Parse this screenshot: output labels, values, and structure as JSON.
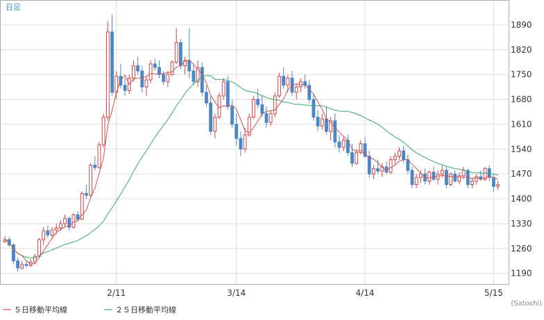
{
  "chart_data": {
    "type": "candlestick",
    "period_label": "日足",
    "credit": "(Satoshi)",
    "y_ticks": [
      1190,
      1260,
      1330,
      1400,
      1470,
      1540,
      1610,
      1680,
      1750,
      1820,
      1890
    ],
    "ylim": [
      1160,
      1960
    ],
    "x_ticks": [
      {
        "label": "2/11",
        "index": 26
      },
      {
        "label": "3/14",
        "index": 54
      },
      {
        "label": "4/14",
        "index": 84
      },
      {
        "label": "5/15",
        "index": 114
      }
    ],
    "n_days": 118,
    "up_color": "#cc4444",
    "down_color": "#4a86c8",
    "ma5_color": "#cc5555",
    "ma25_color": "#33aa66",
    "legend": [
      {
        "label": "５日移動平均線",
        "color": "#cc5555"
      },
      {
        "label": "２５日移動平均線",
        "color": "#33aa66"
      }
    ],
    "candles": [
      [
        1280,
        1295,
        1275,
        1285
      ],
      [
        1285,
        1292,
        1265,
        1270
      ],
      [
        1270,
        1275,
        1215,
        1225
      ],
      [
        1225,
        1235,
        1195,
        1205
      ],
      [
        1205,
        1225,
        1200,
        1215
      ],
      [
        1215,
        1225,
        1205,
        1212
      ],
      [
        1212,
        1230,
        1208,
        1222
      ],
      [
        1222,
        1245,
        1215,
        1238
      ],
      [
        1238,
        1290,
        1232,
        1285
      ],
      [
        1285,
        1320,
        1270,
        1310
      ],
      [
        1310,
        1325,
        1290,
        1298
      ],
      [
        1298,
        1320,
        1288,
        1312
      ],
      [
        1312,
        1330,
        1300,
        1318
      ],
      [
        1318,
        1340,
        1310,
        1330
      ],
      [
        1330,
        1355,
        1320,
        1345
      ],
      [
        1345,
        1350,
        1310,
        1320
      ],
      [
        1320,
        1360,
        1315,
        1355
      ],
      [
        1355,
        1365,
        1335,
        1342
      ],
      [
        1342,
        1420,
        1340,
        1415
      ],
      [
        1415,
        1440,
        1400,
        1410
      ],
      [
        1410,
        1500,
        1405,
        1495
      ],
      [
        1495,
        1520,
        1480,
        1488
      ],
      [
        1488,
        1560,
        1485,
        1552
      ],
      [
        1552,
        1640,
        1545,
        1630
      ],
      [
        1630,
        1900,
        1620,
        1870
      ],
      [
        1870,
        1920,
        1690,
        1700
      ],
      [
        1700,
        1760,
        1680,
        1745
      ],
      [
        1745,
        1780,
        1710,
        1720
      ],
      [
        1720,
        1740,
        1690,
        1705
      ],
      [
        1705,
        1750,
        1695,
        1740
      ],
      [
        1740,
        1790,
        1730,
        1775
      ],
      [
        1775,
        1800,
        1750,
        1760
      ],
      [
        1760,
        1775,
        1700,
        1715
      ],
      [
        1715,
        1745,
        1690,
        1735
      ],
      [
        1735,
        1790,
        1725,
        1780
      ],
      [
        1780,
        1795,
        1760,
        1770
      ],
      [
        1770,
        1790,
        1740,
        1750
      ],
      [
        1750,
        1760,
        1720,
        1730
      ],
      [
        1730,
        1760,
        1715,
        1750
      ],
      [
        1750,
        1790,
        1745,
        1785
      ],
      [
        1785,
        1880,
        1780,
        1840
      ],
      [
        1840,
        1850,
        1765,
        1775
      ],
      [
        1775,
        1800,
        1750,
        1790
      ],
      [
        1790,
        1880,
        1740,
        1760
      ],
      [
        1760,
        1780,
        1720,
        1730
      ],
      [
        1730,
        1790,
        1715,
        1770
      ],
      [
        1770,
        1785,
        1690,
        1700
      ],
      [
        1700,
        1720,
        1660,
        1670
      ],
      [
        1670,
        1690,
        1580,
        1590
      ],
      [
        1590,
        1640,
        1570,
        1630
      ],
      [
        1630,
        1700,
        1625,
        1690
      ],
      [
        1690,
        1740,
        1680,
        1730
      ],
      [
        1730,
        1745,
        1650,
        1660
      ],
      [
        1660,
        1680,
        1600,
        1610
      ],
      [
        1610,
        1640,
        1550,
        1570
      ],
      [
        1570,
        1590,
        1520,
        1540
      ],
      [
        1540,
        1600,
        1530,
        1580
      ],
      [
        1580,
        1640,
        1575,
        1630
      ],
      [
        1630,
        1690,
        1625,
        1680
      ],
      [
        1680,
        1710,
        1655,
        1665
      ],
      [
        1665,
        1690,
        1630,
        1640
      ],
      [
        1640,
        1660,
        1600,
        1615
      ],
      [
        1615,
        1650,
        1605,
        1640
      ],
      [
        1640,
        1700,
        1630,
        1690
      ],
      [
        1690,
        1755,
        1685,
        1745
      ],
      [
        1745,
        1770,
        1710,
        1720
      ],
      [
        1720,
        1750,
        1700,
        1740
      ],
      [
        1740,
        1760,
        1690,
        1700
      ],
      [
        1700,
        1725,
        1680,
        1715
      ],
      [
        1715,
        1740,
        1700,
        1730
      ],
      [
        1730,
        1750,
        1710,
        1720
      ],
      [
        1720,
        1735,
        1670,
        1680
      ],
      [
        1680,
        1695,
        1620,
        1630
      ],
      [
        1630,
        1650,
        1590,
        1605
      ],
      [
        1605,
        1640,
        1595,
        1625
      ],
      [
        1625,
        1660,
        1580,
        1590
      ],
      [
        1590,
        1630,
        1565,
        1620
      ],
      [
        1620,
        1640,
        1545,
        1560
      ],
      [
        1560,
        1580,
        1530,
        1545
      ],
      [
        1545,
        1575,
        1535,
        1565
      ],
      [
        1565,
        1580,
        1520,
        1530
      ],
      [
        1530,
        1555,
        1490,
        1500
      ],
      [
        1500,
        1540,
        1495,
        1530
      ],
      [
        1530,
        1565,
        1525,
        1555
      ],
      [
        1555,
        1575,
        1515,
        1520
      ],
      [
        1520,
        1535,
        1460,
        1470
      ],
      [
        1470,
        1495,
        1455,
        1485
      ],
      [
        1485,
        1510,
        1470,
        1478
      ],
      [
        1478,
        1500,
        1462,
        1490
      ],
      [
        1490,
        1505,
        1470,
        1475
      ],
      [
        1475,
        1520,
        1470,
        1510
      ],
      [
        1510,
        1530,
        1495,
        1520
      ],
      [
        1520,
        1545,
        1510,
        1535
      ],
      [
        1535,
        1550,
        1500,
        1510
      ],
      [
        1510,
        1525,
        1470,
        1480
      ],
      [
        1480,
        1490,
        1430,
        1440
      ],
      [
        1440,
        1470,
        1430,
        1460
      ],
      [
        1460,
        1480,
        1445,
        1470
      ],
      [
        1470,
        1485,
        1440,
        1450
      ],
      [
        1450,
        1480,
        1440,
        1475
      ],
      [
        1475,
        1490,
        1450,
        1455
      ],
      [
        1455,
        1480,
        1440,
        1470
      ],
      [
        1470,
        1495,
        1460,
        1480
      ],
      [
        1480,
        1490,
        1430,
        1440
      ],
      [
        1440,
        1475,
        1435,
        1470
      ],
      [
        1470,
        1480,
        1445,
        1450
      ],
      [
        1450,
        1475,
        1440,
        1465
      ],
      [
        1465,
        1490,
        1455,
        1480
      ],
      [
        1480,
        1485,
        1430,
        1440
      ],
      [
        1440,
        1460,
        1430,
        1450
      ],
      [
        1450,
        1470,
        1440,
        1462
      ],
      [
        1462,
        1480,
        1450,
        1455
      ],
      [
        1455,
        1490,
        1450,
        1485
      ],
      [
        1485,
        1495,
        1450,
        1460
      ],
      [
        1460,
        1470,
        1420,
        1435
      ],
      [
        1435,
        1450,
        1425,
        1440
      ]
    ]
  }
}
